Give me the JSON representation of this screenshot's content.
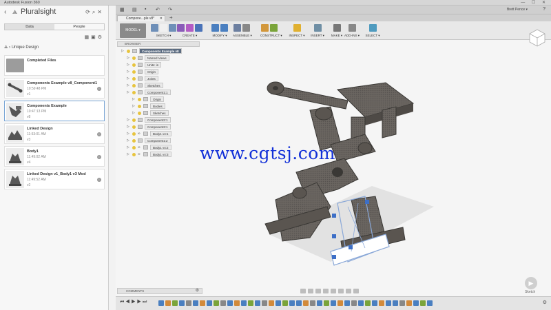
{
  "window": {
    "title": "Autodesk Fusion 360",
    "controls": "— ☐ ✕"
  },
  "data_panel": {
    "back_icon": "back-arrow",
    "brand": "Pluralsight",
    "tabs": [
      "Data",
      "People"
    ],
    "breadcrumb": "Unique Design",
    "folder": {
      "title": "Completed Files"
    },
    "items": [
      {
        "title": "Components Example v8_Component1",
        "time": "10:59:48 PM",
        "version": "v1"
      },
      {
        "title": "Components Example",
        "time": "10:47:13 PM",
        "version": "v8"
      },
      {
        "title": "Linked Design",
        "time": "11:53:01 AM",
        "version": "v3"
      },
      {
        "title": "Body1",
        "time": "11:49:02 AM",
        "version": "v4"
      },
      {
        "title": "Linked Design v1_Body1 v3 Mod",
        "time": "11:49:52 AM",
        "version": "v2"
      }
    ]
  },
  "quickbar": {
    "user": "Brett Pence ▾",
    "help": "?"
  },
  "doc_tab": {
    "label": "Compone...ple v8*"
  },
  "toolbar": {
    "workspace": "MODEL ▾",
    "groups": [
      {
        "label": "SKETCH ▾",
        "colors": [
          "#6e8fb8",
          "#f0f0f0",
          "#6e8fb8"
        ]
      },
      {
        "label": "CREATE ▾",
        "colors": [
          "#8a5bb8",
          "#b35cc4",
          "#4a73b8"
        ]
      },
      {
        "label": "MODIFY ▾",
        "colors": [
          "#4a7fc0",
          "#4a7fc0"
        ]
      },
      {
        "label": "ASSEMBLE ▾",
        "colors": [
          "#6c7fa0",
          "#888888"
        ]
      },
      {
        "label": "CONSTRUCT ▾",
        "colors": [
          "#d2973b",
          "#7aa43a"
        ]
      },
      {
        "label": "INSPECT ▾",
        "colors": [
          "#e0b030"
        ]
      },
      {
        "label": "INSERT ▾",
        "colors": [
          "#6f8fa5"
        ]
      },
      {
        "label": "MAKE ▾",
        "colors": [
          "#777777"
        ]
      },
      {
        "label": "ADD-INS ▾",
        "colors": [
          "#888888"
        ]
      },
      {
        "label": "SELECT ▾",
        "colors": [
          "#4f9bbf"
        ]
      }
    ]
  },
  "browser": {
    "title": "BROWSER",
    "nodes": [
      {
        "label": "Components Example v8",
        "indent": 0,
        "root": true
      },
      {
        "label": "Named Views",
        "indent": 1
      },
      {
        "label": "Units: in",
        "indent": 1
      },
      {
        "label": "Origin",
        "indent": 1
      },
      {
        "label": "Joints",
        "indent": 1
      },
      {
        "label": "Sketches",
        "indent": 1
      },
      {
        "label": "Component1:1",
        "indent": 1
      },
      {
        "label": "Origin",
        "indent": 2
      },
      {
        "label": "Bodies",
        "indent": 2
      },
      {
        "label": "Sketches",
        "indent": 2
      },
      {
        "label": "Component2:1",
        "indent": 1
      },
      {
        "label": "Component3:1",
        "indent": 1
      },
      {
        "label": "Body1 v4:1",
        "indent": 1,
        "link": true
      },
      {
        "label": "Component1:2",
        "indent": 1
      },
      {
        "label": "Body1 v4:2",
        "indent": 1,
        "link": true
      },
      {
        "label": "Body1 v4:3",
        "indent": 1,
        "link": true
      }
    ]
  },
  "watermark": "www.cgtsj.com",
  "sketch_logo": "Sketch",
  "comments": {
    "title": "COMMENTS"
  }
}
